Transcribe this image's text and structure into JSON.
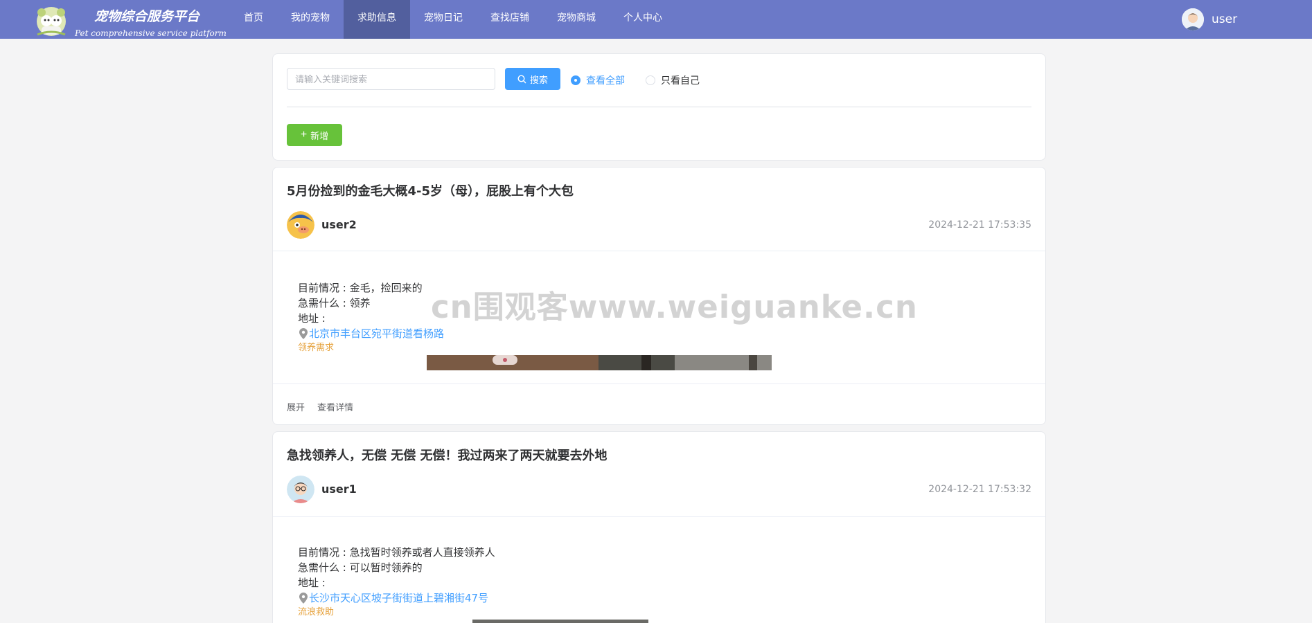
{
  "brand": {
    "title": "宠物综合服务平台",
    "subtitle": "Pet comprehensive service platform"
  },
  "nav": {
    "items": [
      "首页",
      "我的宠物",
      "求助信息",
      "宠物日记",
      "查找店铺",
      "宠物商城",
      "个人中心"
    ],
    "active_index": 2
  },
  "user": {
    "name": "user"
  },
  "search": {
    "placeholder": "请输入关键词搜索",
    "button_label": "搜索",
    "filters": [
      {
        "label": "查看全部",
        "checked": true
      },
      {
        "label": "只看自己",
        "checked": false
      }
    ],
    "add_label": "新增"
  },
  "posts": [
    {
      "title": "5月份捡到的金毛大概4-5岁（母），屁股上有个大包",
      "author": "user2",
      "time": "2024-12-21 17:53:35",
      "situation": "目前情况 : 金毛，捡回来的",
      "need": "急需什么 : 领养",
      "address_label": "地址 :",
      "address": "北京市丰台区宛平街道看杨路",
      "tag": "领养需求",
      "actions": [
        "展开",
        "查看详情"
      ]
    },
    {
      "title": "急找领养人，无偿 无偿 无偿！我过两来了两天就要去外地",
      "author": "user1",
      "time": "2024-12-21 17:53:32",
      "situation": "目前情况 : 急找暂时领养或者人直接领养人",
      "need": "急需什么 : 可以暂时领养的",
      "address_label": "地址 :",
      "address": "长沙市天心区坡子街街道上碧湘街47号",
      "tag": "流浪救助"
    }
  ],
  "watermark": "cn围观客www.weiguanke.cn",
  "colors": {
    "nav_bg": "#6b79c8",
    "nav_active": "#525f9e",
    "primary": "#409eff",
    "success": "#67c23a",
    "tag": "#e6a23c"
  }
}
